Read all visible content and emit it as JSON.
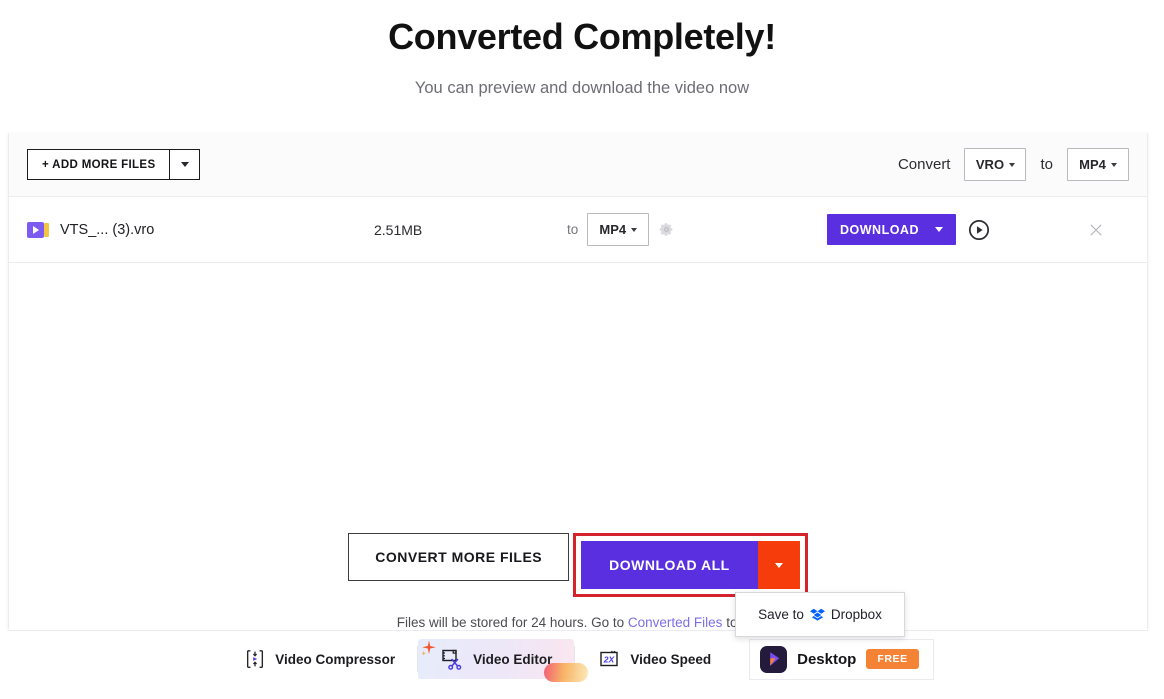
{
  "hero": {
    "title": "Converted Completely!",
    "subtitle": "You can preview and download the video now"
  },
  "toolbar": {
    "add_more_files": "+ ADD MORE FILES",
    "convert_label": "Convert",
    "source_format": "VRO",
    "to_label": "to",
    "target_format": "MP4"
  },
  "file_row": {
    "name": "VTS_... (3).vro",
    "size": "2.51MB",
    "to_label": "to",
    "output_format": "MP4",
    "download_label": "DOWNLOAD"
  },
  "actions": {
    "convert_more": "CONVERT MORE FILES",
    "download_all": "DOWNLOAD ALL"
  },
  "notice": {
    "prefix": "Files will be stored for 24 hours. Go to ",
    "link": "Converted Files",
    "suffix": " to del"
  },
  "dropdown": {
    "save_to": "Save to",
    "provider": "Dropbox"
  },
  "footer": {
    "items": [
      {
        "label": "Video Compressor",
        "icon": "compress-icon"
      },
      {
        "label": "Video Editor",
        "icon": "film-scissors-icon"
      },
      {
        "label": "Video Speed",
        "icon": "speed-2x-icon"
      }
    ],
    "desktop": {
      "label": "Desktop",
      "badge": "FREE",
      "icon": "desktop-app-icon"
    },
    "speed_icon_text": "2X"
  },
  "colors": {
    "purple": "#5a2fe0",
    "orange": "#f63c0a",
    "highlight_red": "#d5232c",
    "link": "#7b6fe8",
    "free_badge": "#f58336",
    "dropbox_blue": "#0061fe"
  }
}
